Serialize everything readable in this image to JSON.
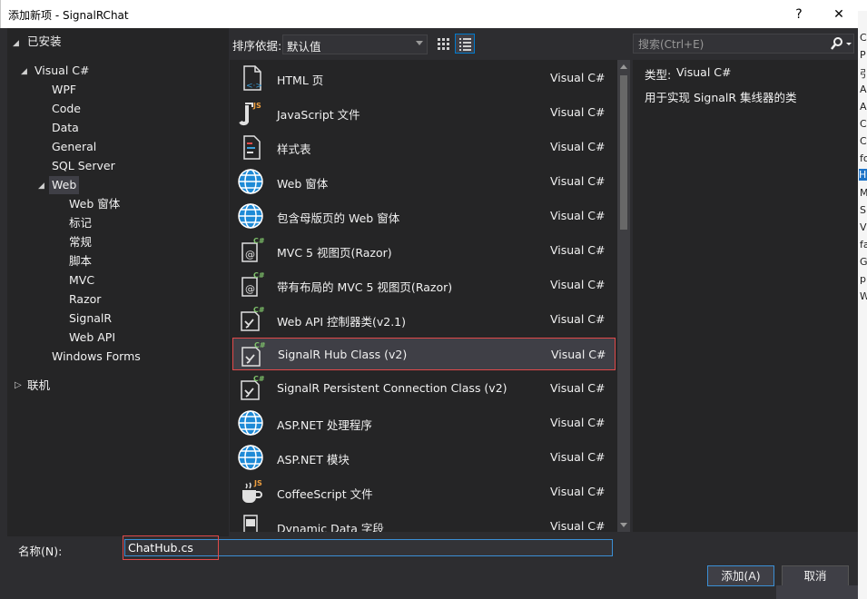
{
  "window": {
    "title": "添加新项 - SignalRChat",
    "help_glyph": "?",
    "close_glyph": "✕"
  },
  "tree": {
    "installed": "已安装",
    "visual_cs": "Visual C#",
    "children": [
      "WPF",
      "Code",
      "Data",
      "General",
      "SQL Server"
    ],
    "web": "Web",
    "web_children": [
      "Web 窗体",
      "标记",
      "常规",
      "脚本",
      "MVC",
      "Razor",
      "SignalR",
      "Web API"
    ],
    "windows_forms": "Windows Forms",
    "online": "联机"
  },
  "toolbar": {
    "sort_label": "排序依据:",
    "sort_value": "默认值"
  },
  "search": {
    "placeholder": "搜索(Ctrl+E)"
  },
  "items": [
    {
      "name": "HTML 页",
      "lang": "Visual C#",
      "icon": "html-page-icon"
    },
    {
      "name": "JavaScript 文件",
      "lang": "Visual C#",
      "icon": "javascript-file-icon"
    },
    {
      "name": "样式表",
      "lang": "Visual C#",
      "icon": "stylesheet-icon"
    },
    {
      "name": "Web 窗体",
      "lang": "Visual C#",
      "icon": "globe-icon"
    },
    {
      "name": "包含母版页的 Web 窗体",
      "lang": "Visual C#",
      "icon": "globe-icon"
    },
    {
      "name": "MVC 5 视图页(Razor)",
      "lang": "Visual C#",
      "icon": "razor-view-icon"
    },
    {
      "name": "带有布局的 MVC 5 视图页(Razor)",
      "lang": "Visual C#",
      "icon": "razor-view-icon"
    },
    {
      "name": "Web API 控制器类(v2.1)",
      "lang": "Visual C#",
      "icon": "cs-class-icon"
    },
    {
      "name": "SignalR Hub Class (v2)",
      "lang": "Visual C#",
      "icon": "cs-class-icon"
    },
    {
      "name": "SignalR Persistent Connection Class (v2)",
      "lang": "Visual C#",
      "icon": "cs-class-icon"
    },
    {
      "name": "ASP.NET 处理程序",
      "lang": "Visual C#",
      "icon": "globe-icon"
    },
    {
      "name": "ASP.NET 模块",
      "lang": "Visual C#",
      "icon": "globe-icon"
    },
    {
      "name": "CoffeeScript 文件",
      "lang": "Visual C#",
      "icon": "coffee-cup-icon"
    },
    {
      "name": "Dynamic Data 字段",
      "lang": "Visual C#",
      "icon": "dynamic-data-icon"
    }
  ],
  "details": {
    "type_label": "类型:",
    "type_value": "Visual C#",
    "description": "用于实现 SignalR 集线器的类"
  },
  "name_field": {
    "label": "名称(N):",
    "value": "ChatHub.cs"
  },
  "buttons": {
    "add": "添加(A)",
    "cancel": "取消"
  },
  "bg_strip": [
    "C",
    "P",
    "引",
    "A",
    "A",
    "C",
    "C",
    "fo",
    "H",
    "M",
    "S",
    "V",
    "fa",
    "G",
    "p",
    "W"
  ],
  "colors": {
    "accent": "#007acc",
    "highlight": "#e24a4a",
    "selection": "#3f3f46"
  }
}
